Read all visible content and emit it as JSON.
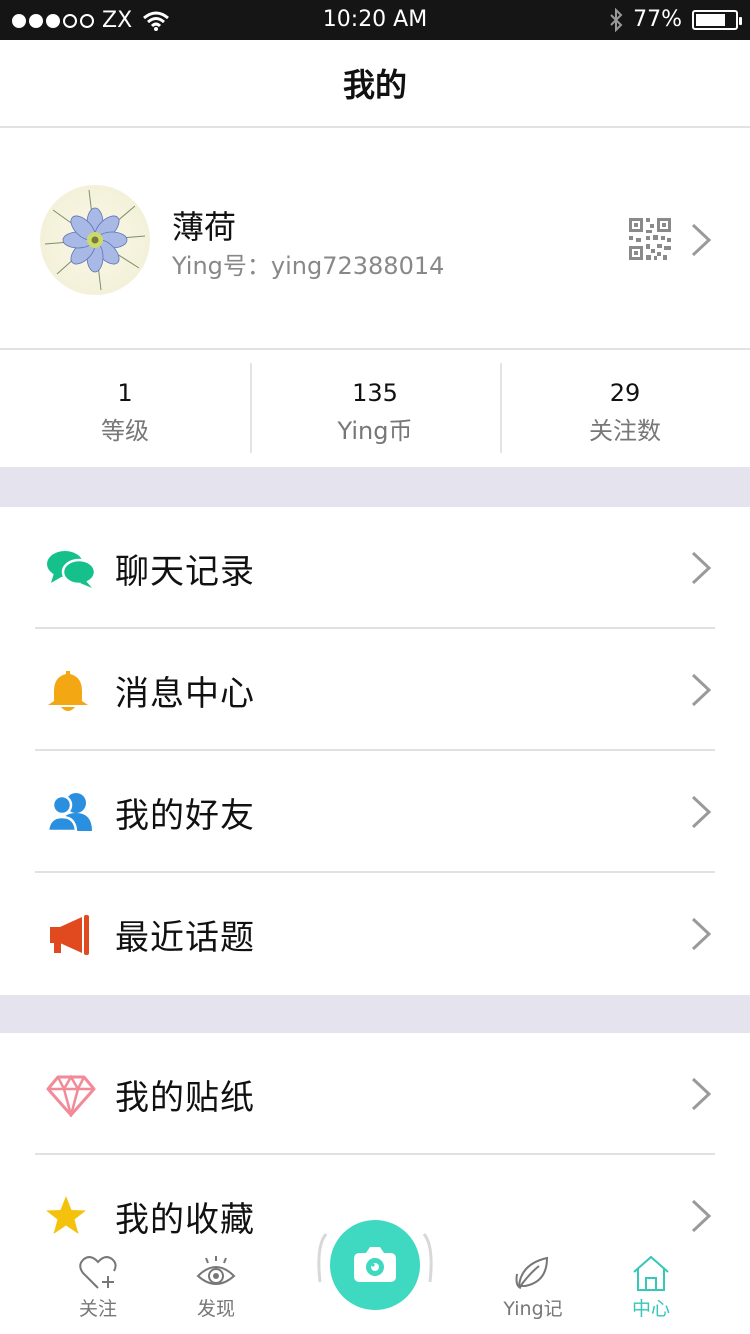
{
  "status_bar": {
    "carrier": "ZX",
    "time": "10:20 AM",
    "battery": "77%",
    "battery_level": 0.77,
    "signal_strength": 3,
    "signal_max": 5
  },
  "header": {
    "title": "我的"
  },
  "profile": {
    "name": "薄荷",
    "id_text": "Ying号：ying72388014"
  },
  "stats": [
    {
      "value": "1",
      "label": "等级"
    },
    {
      "value": "135",
      "label": "Ying币"
    },
    {
      "value": "29",
      "label": "关注数"
    }
  ],
  "menu_group_1": [
    {
      "label": "聊天记录",
      "icon": "chat-bubbles-icon",
      "color": "#16c08a"
    },
    {
      "label": "消息中心",
      "icon": "bell-icon",
      "color": "#f3a712"
    },
    {
      "label": "我的好友",
      "icon": "friends-icon",
      "color": "#2b8fe0"
    },
    {
      "label": "最近话题",
      "icon": "megaphone-icon",
      "color": "#e04a1e"
    }
  ],
  "menu_group_2": [
    {
      "label": "我的贴纸",
      "icon": "diamond-icon",
      "color": "#f28a97"
    },
    {
      "label": "我的收藏",
      "icon": "star-icon",
      "color": "#f4c20d"
    }
  ],
  "tab_bar": {
    "accent": "#35c7b8",
    "camera_color": "#3ed9c0",
    "tabs": [
      {
        "label": "关注",
        "icon": "heart-plus-icon"
      },
      {
        "label": "发现",
        "icon": "eye-icon"
      },
      {
        "label": "Ying记",
        "icon": "leaf-icon"
      },
      {
        "label": "中心",
        "icon": "home-icon",
        "active": true
      }
    ]
  }
}
